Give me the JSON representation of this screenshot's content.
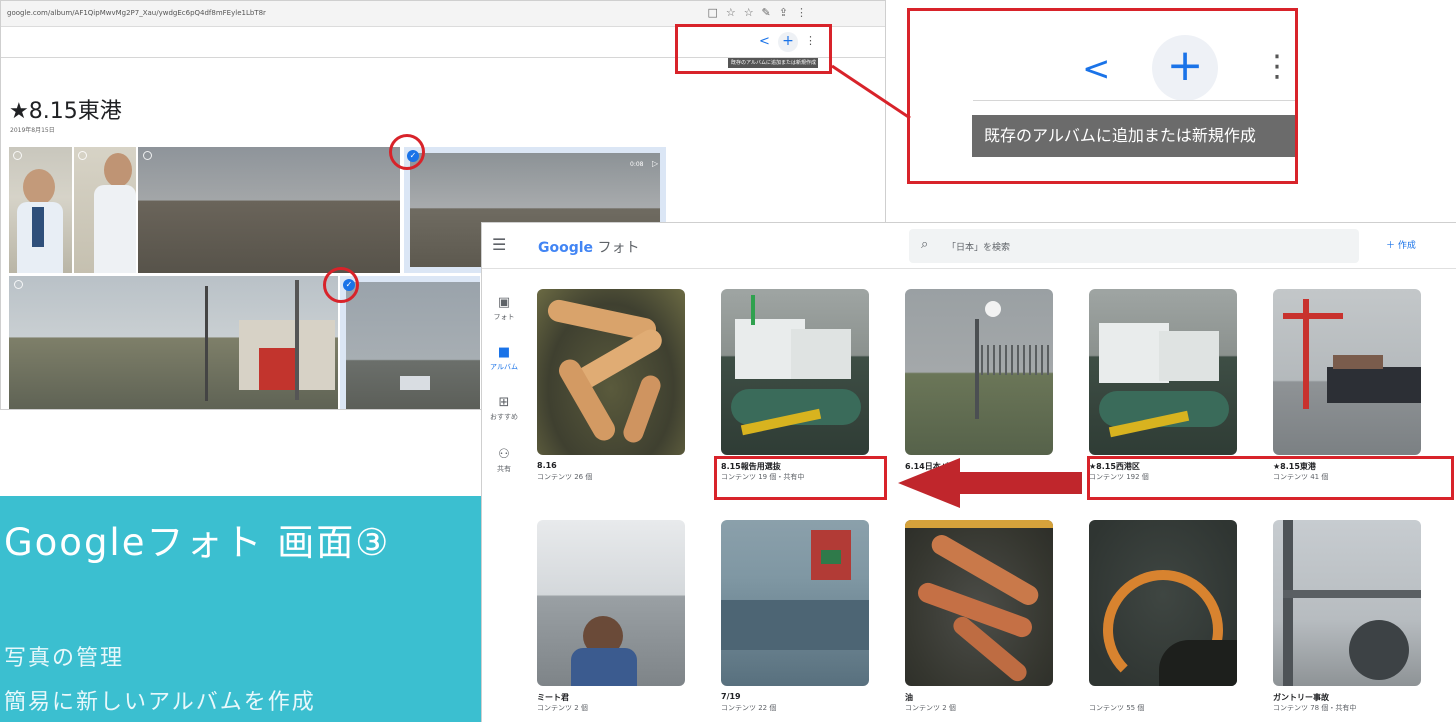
{
  "album_page": {
    "url": "google.com/album/AF1QipMwvMg2P7_Xau/ywdgEc6pQ4df8mFEyle1LbT8r",
    "title": "★8.15東港",
    "date": "2019年8月15日",
    "video_duration": "0:08",
    "tooltip": "既存のアルバムに追加または新規作成"
  },
  "zoom": {
    "tooltip": "既存のアルバムに追加または新規作成"
  },
  "caption": {
    "title": "Googleフォト 画面③",
    "line1": "写真の管理",
    "line2": "簡易に新しいアルバムを作成"
  },
  "gphotos": {
    "app_name": "フォト",
    "brand": "Google",
    "search_placeholder": "「日本」を検索",
    "create_label": "作成",
    "nav": [
      {
        "label": "フォト",
        "icon": "photo-icon"
      },
      {
        "label": "アルバム",
        "icon": "album-icon"
      },
      {
        "label": "おすすめ",
        "icon": "for-you-icon"
      },
      {
        "label": "共有",
        "icon": "sharing-icon"
      }
    ],
    "albums": [
      {
        "title": "8.16",
        "meta": "コンテンツ 26 個"
      },
      {
        "title": "8.15報告用選抜",
        "meta": "コンテンツ 19 個・共有中"
      },
      {
        "title": "6.14日本パト",
        "meta": ""
      },
      {
        "title": "★8.15西港区",
        "meta": "コンテンツ 192 個"
      },
      {
        "title": "★8.15東港",
        "meta": "コンテンツ 41 個"
      },
      {
        "title": "ミート君",
        "meta": "コンテンツ 2 個"
      },
      {
        "title": "7/19",
        "meta": "コンテンツ 22 個"
      },
      {
        "title": "油",
        "meta": "コンテンツ 2 個"
      },
      {
        "title": "",
        "meta": "コンテンツ 55 個"
      },
      {
        "title": "ガントリー事故",
        "meta": "コンテンツ 78 個・共有中"
      }
    ]
  }
}
